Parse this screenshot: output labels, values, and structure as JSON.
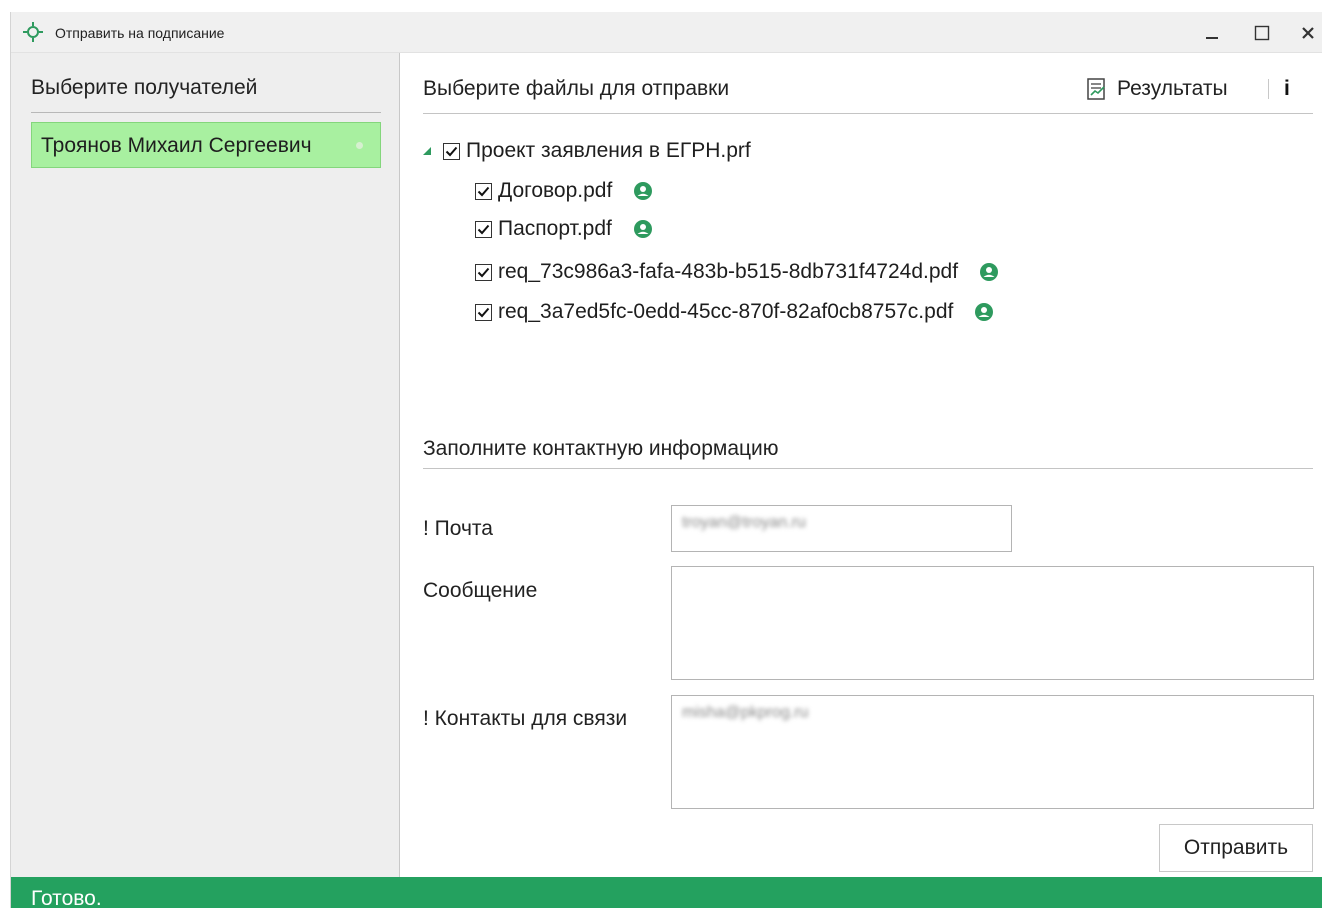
{
  "window": {
    "title": "Отправить на подписание",
    "minimize_label": "_",
    "maximize_label": "☐",
    "close_label": "✕"
  },
  "recipients": {
    "header": "Выберите получателей",
    "items": [
      {
        "name": "Троянов Михаил Сергеевич"
      }
    ]
  },
  "files": {
    "header": "Выберите файлы для отправки",
    "results_label": "Результаты",
    "info_label": "i",
    "root": {
      "name": "Проект заявления в ЕГРН.prf",
      "checked": true,
      "expanded": true
    },
    "children": [
      {
        "name": "Договор.pdf",
        "checked": true
      },
      {
        "name": "Паспорт.pdf",
        "checked": true
      },
      {
        "name": "req_73c986a3-fafa-483b-b515-8db731f4724d.pdf",
        "checked": true
      },
      {
        "name": "req_3a7ed5fc-0edd-45cc-870f-82af0cb8757c.pdf",
        "checked": true
      }
    ]
  },
  "contact": {
    "header": "Заполните контактную информацию",
    "email_label": "! Почта",
    "email_value": "troyan@troyan.ru",
    "message_label": "Сообщение",
    "message_value": "",
    "contacts_label": "! Контакты для связи",
    "contacts_value": "misha@pkprog.ru",
    "send_label": "Отправить"
  },
  "status": {
    "text": "Готово."
  },
  "colors": {
    "accent": "#24a15f",
    "recipient_bg": "#a8f0a0",
    "person_icon": "#2e9a5e"
  },
  "icons": {
    "title": "target-icon",
    "results": "report-icon",
    "file_owner": "person-icon"
  }
}
